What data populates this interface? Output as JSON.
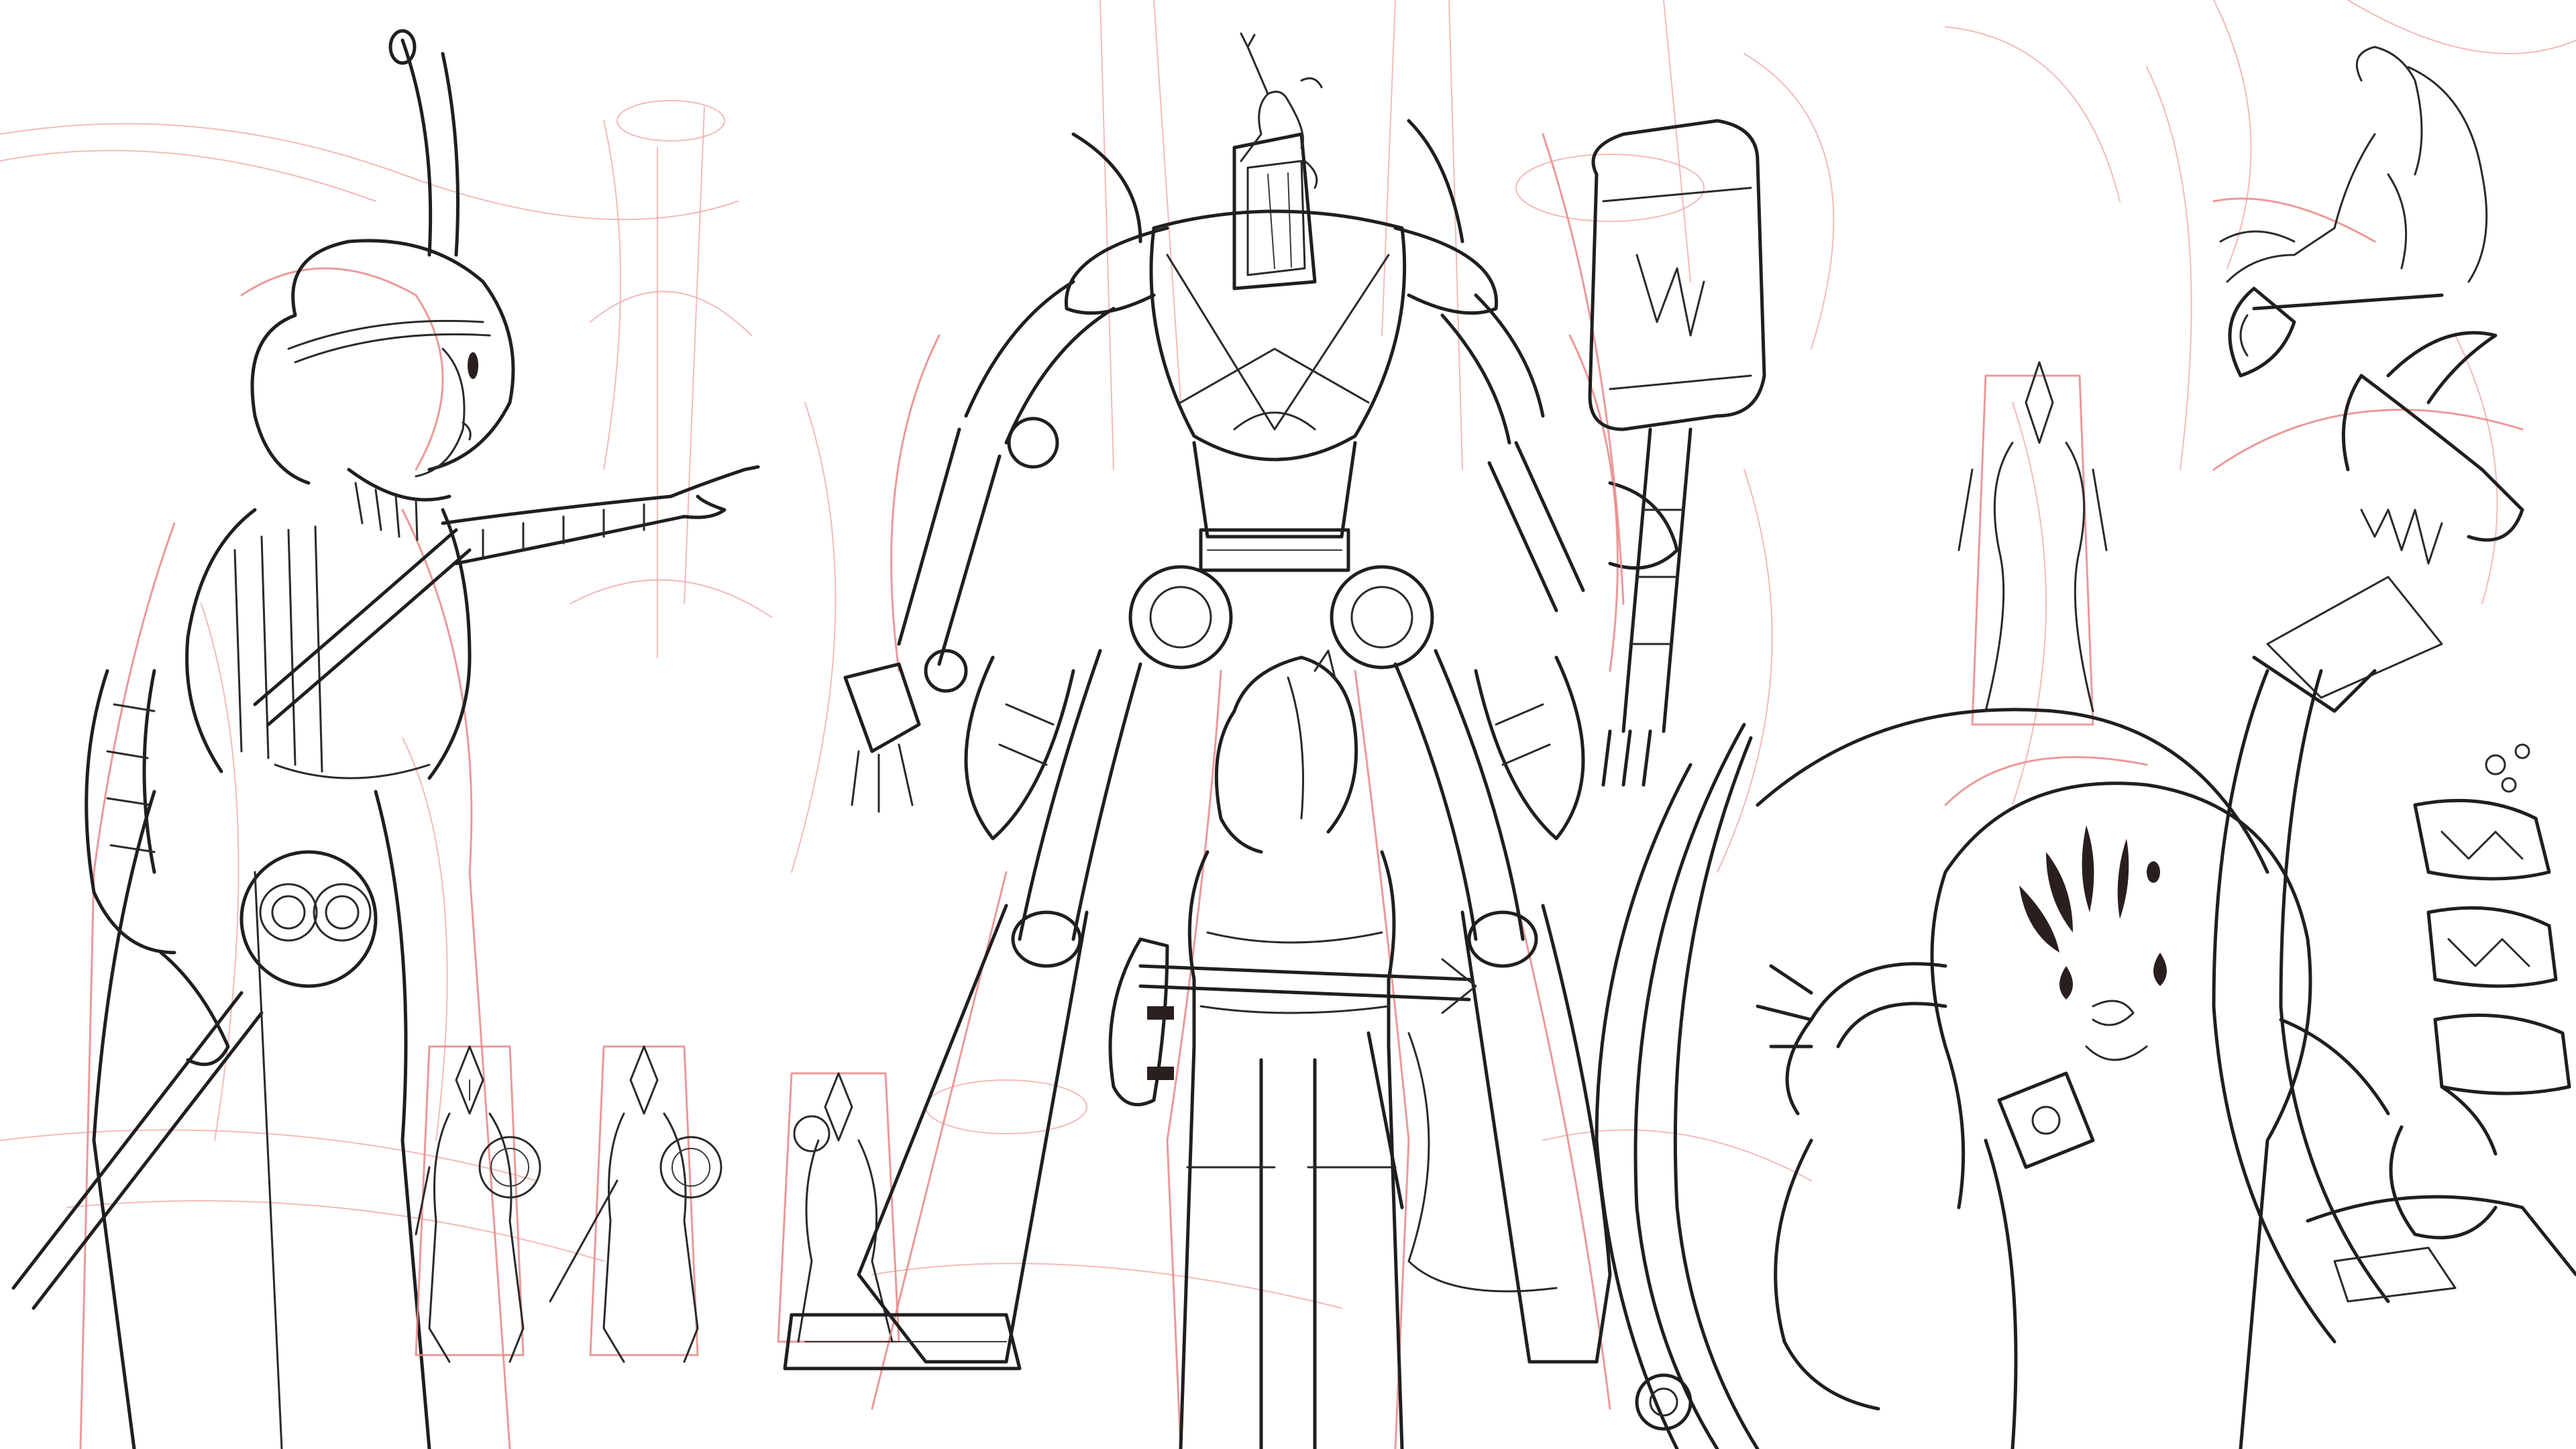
{
  "scene": {
    "background_color": "#ffffff",
    "line_color": "#1f1f1f",
    "sketch_color": "#e98787"
  },
  "figures": {
    "princess": "princess-figure",
    "robot": "giant-robot",
    "imp": "imp-on-robot-head",
    "hammer": "giant-hammer",
    "hero": "central-hero",
    "soldiers": [
      "soldier-1",
      "soldier-2",
      "soldier-3"
    ],
    "queen": "queen-on-dome",
    "flyer": "girl-on-axe",
    "monster": "shadow-monster",
    "dragon": "armored-creature"
  }
}
